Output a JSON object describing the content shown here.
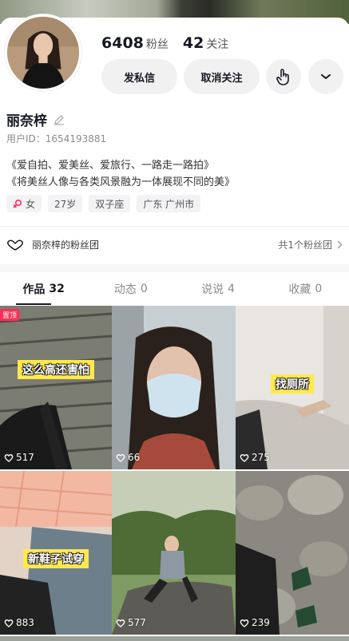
{
  "profile": {
    "followers_count": "6408",
    "followers_label": "粉丝",
    "following_count": "42",
    "following_label": "关注",
    "name": "丽奈梓",
    "user_id": "用户ID：1654193881",
    "bio_line1": "《爱自拍、爱美丝、爱旅行、一路走一路拍》",
    "bio_line2": "《将美丝人像与各类风景融为一体展现不同的美》",
    "tags": {
      "gender": "女",
      "age": "27岁",
      "zodiac": "双子座",
      "location": "广东 广州市"
    }
  },
  "actions": {
    "message_label": "发私信",
    "unfollow_label": "取消关注"
  },
  "fan_group": {
    "left_label": "丽奈梓的粉丝团",
    "right_label": "共1个粉丝团"
  },
  "tabs": [
    {
      "label": "作品",
      "count": "32"
    },
    {
      "label": "动态",
      "count": "0"
    },
    {
      "label": "说说",
      "count": "4"
    },
    {
      "label": "收藏",
      "count": "0"
    }
  ],
  "videos": [
    {
      "likes": "517",
      "caption": "这么高还害怕",
      "pinned_label": "置顶"
    },
    {
      "likes": "66",
      "caption": ""
    },
    {
      "likes": "275",
      "caption": "找厕所"
    },
    {
      "likes": "883",
      "caption": "新鞋子试穿"
    },
    {
      "likes": "577",
      "caption": ""
    },
    {
      "likes": "239",
      "caption": ""
    }
  ],
  "colors": {
    "accent": "#fe2c55",
    "caption_bg": "#ffe94d",
    "button_bg": "#f1f1f2"
  },
  "icons": {
    "edit": "pencil-icon",
    "hand": "hand-pointer-icon",
    "chevron": "chevron-down-icon",
    "female": "female-icon",
    "fan_group": "heart-outline-icon",
    "arrow": "chevron-right-icon",
    "like": "heart-outline-icon"
  }
}
